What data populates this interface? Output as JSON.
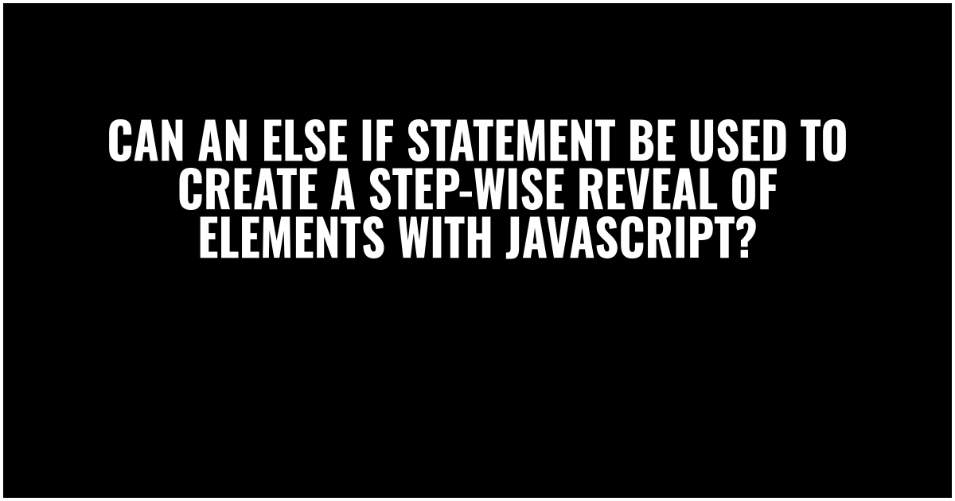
{
  "headline": "Can an else if statement be used to create a step-wise reveal of elements with JavaScript?"
}
